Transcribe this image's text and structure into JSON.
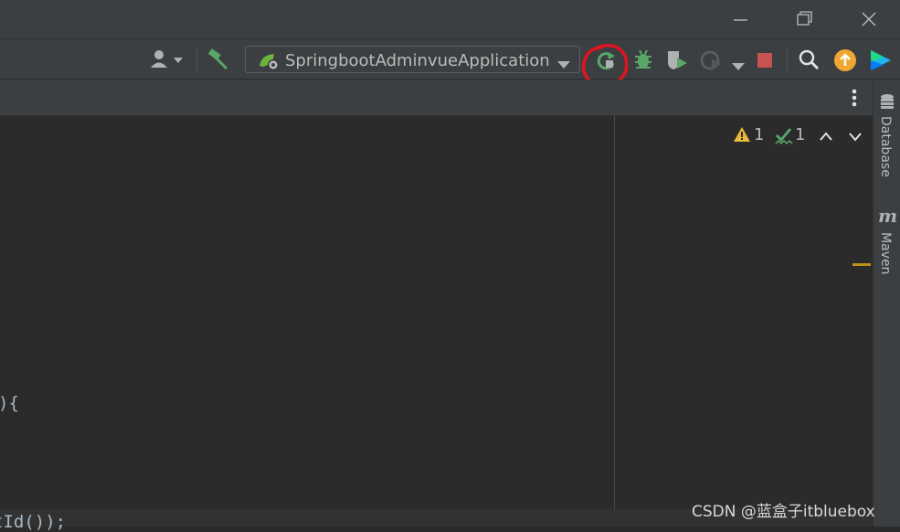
{
  "window": {
    "minimize_icon": "minimize-icon",
    "restore_icon": "restore-icon",
    "close_icon": "close-icon"
  },
  "toolbar": {
    "run_config_label": "SpringbootAdminvueApplication",
    "icons": [
      "user-icon",
      "build-hammer-icon",
      "spring-boot-icon",
      "rerun-icon",
      "debug-bug-icon",
      "coverage-icon",
      "profile-icon",
      "stop-icon",
      "search-icon",
      "update-icon",
      "toolbox-icon"
    ]
  },
  "tabbar": {
    "more_icon": "more-vertical-icon"
  },
  "inspections": {
    "warnings": "1",
    "ok_count": "1"
  },
  "editor": {
    "code_line_1": "){",
    "code_line_2": "tId());"
  },
  "right_stripe": {
    "database_label": "Database",
    "maven_label": "Maven"
  },
  "watermark": "CSDN @蓝盒子itbluebox",
  "colors": {
    "annotation_red": "#e0141e",
    "spring_green": "#6cb33e",
    "stop_red": "#c75450",
    "warning_yellow": "#e8b93a",
    "update_orange": "#f0a732"
  }
}
